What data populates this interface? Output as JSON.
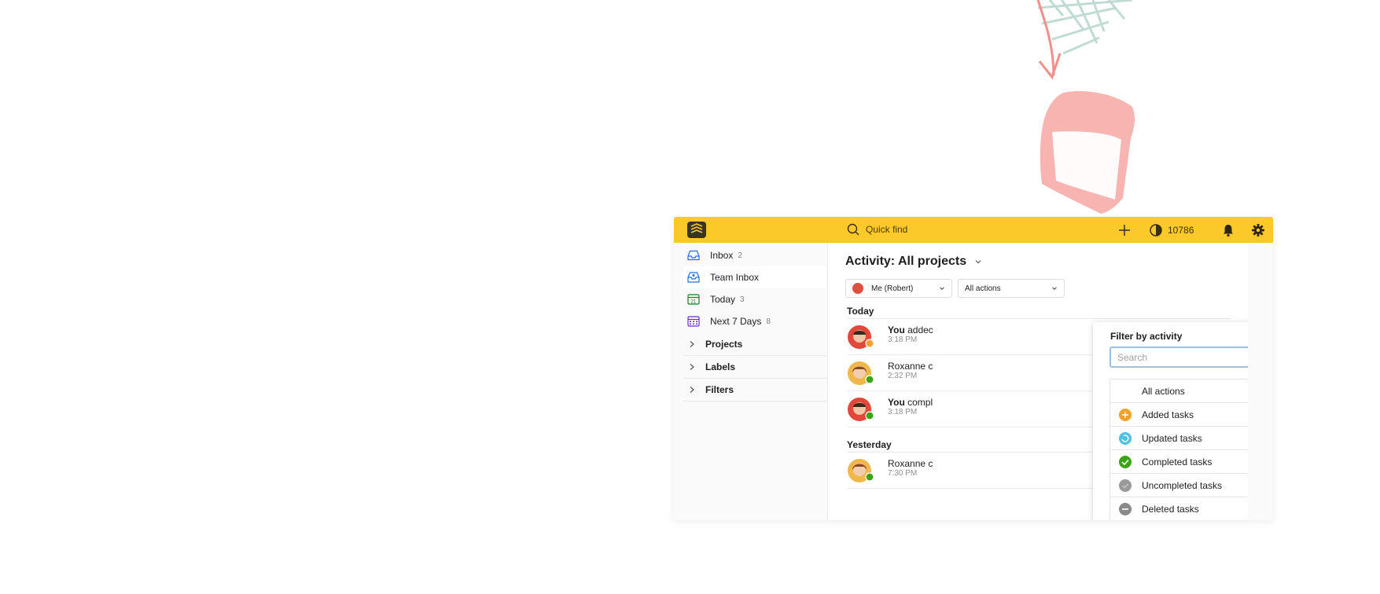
{
  "colors": {
    "brand_yellow": "#fcc92b",
    "added": "#f2a229",
    "updated": "#4dc1e6",
    "completed": "#3aa415",
    "uncompleted": "#999999",
    "deleted": "#8a8a8a"
  },
  "topbar": {
    "logo_icon": "app-logo-icon",
    "search_label": "Quick find",
    "karma_value": "10786"
  },
  "sidebar": {
    "items": [
      {
        "label": "Inbox",
        "count": "2",
        "icon": "inbox-icon"
      },
      {
        "label": "Team Inbox",
        "count": "",
        "icon": "team-inbox-icon"
      },
      {
        "label": "Today",
        "count": "3",
        "icon": "calendar-today-icon"
      },
      {
        "label": "Next 7 Days",
        "count": "8",
        "icon": "calendar-week-icon"
      }
    ],
    "groups": [
      {
        "label": "Projects"
      },
      {
        "label": "Labels"
      },
      {
        "label": "Filters"
      }
    ]
  },
  "main": {
    "title": "Activity: All projects",
    "filter_user": "Me (Robert)",
    "filter_action": "All actions",
    "sections": [
      {
        "heading": "Today"
      },
      {
        "heading": "Yesterday"
      }
    ],
    "activities": [
      {
        "actor": "You",
        "text": " addec",
        "time": "3:18 PM"
      },
      {
        "actor": "",
        "text": "Roxanne c",
        "time": "2:32 PM"
      },
      {
        "actor": "You",
        "text": " compl",
        "time": "3:18 PM"
      },
      {
        "actor": "",
        "text": "Roxanne c",
        "time": "7:30 PM"
      }
    ]
  },
  "popup": {
    "title": "Filter by activity",
    "search_placeholder": "Search",
    "options": [
      {
        "label": "All actions"
      },
      {
        "label": "Added tasks"
      },
      {
        "label": "Updated tasks"
      },
      {
        "label": "Completed tasks"
      },
      {
        "label": "Uncompleted tasks"
      },
      {
        "label": "Deleted tasks"
      }
    ]
  }
}
